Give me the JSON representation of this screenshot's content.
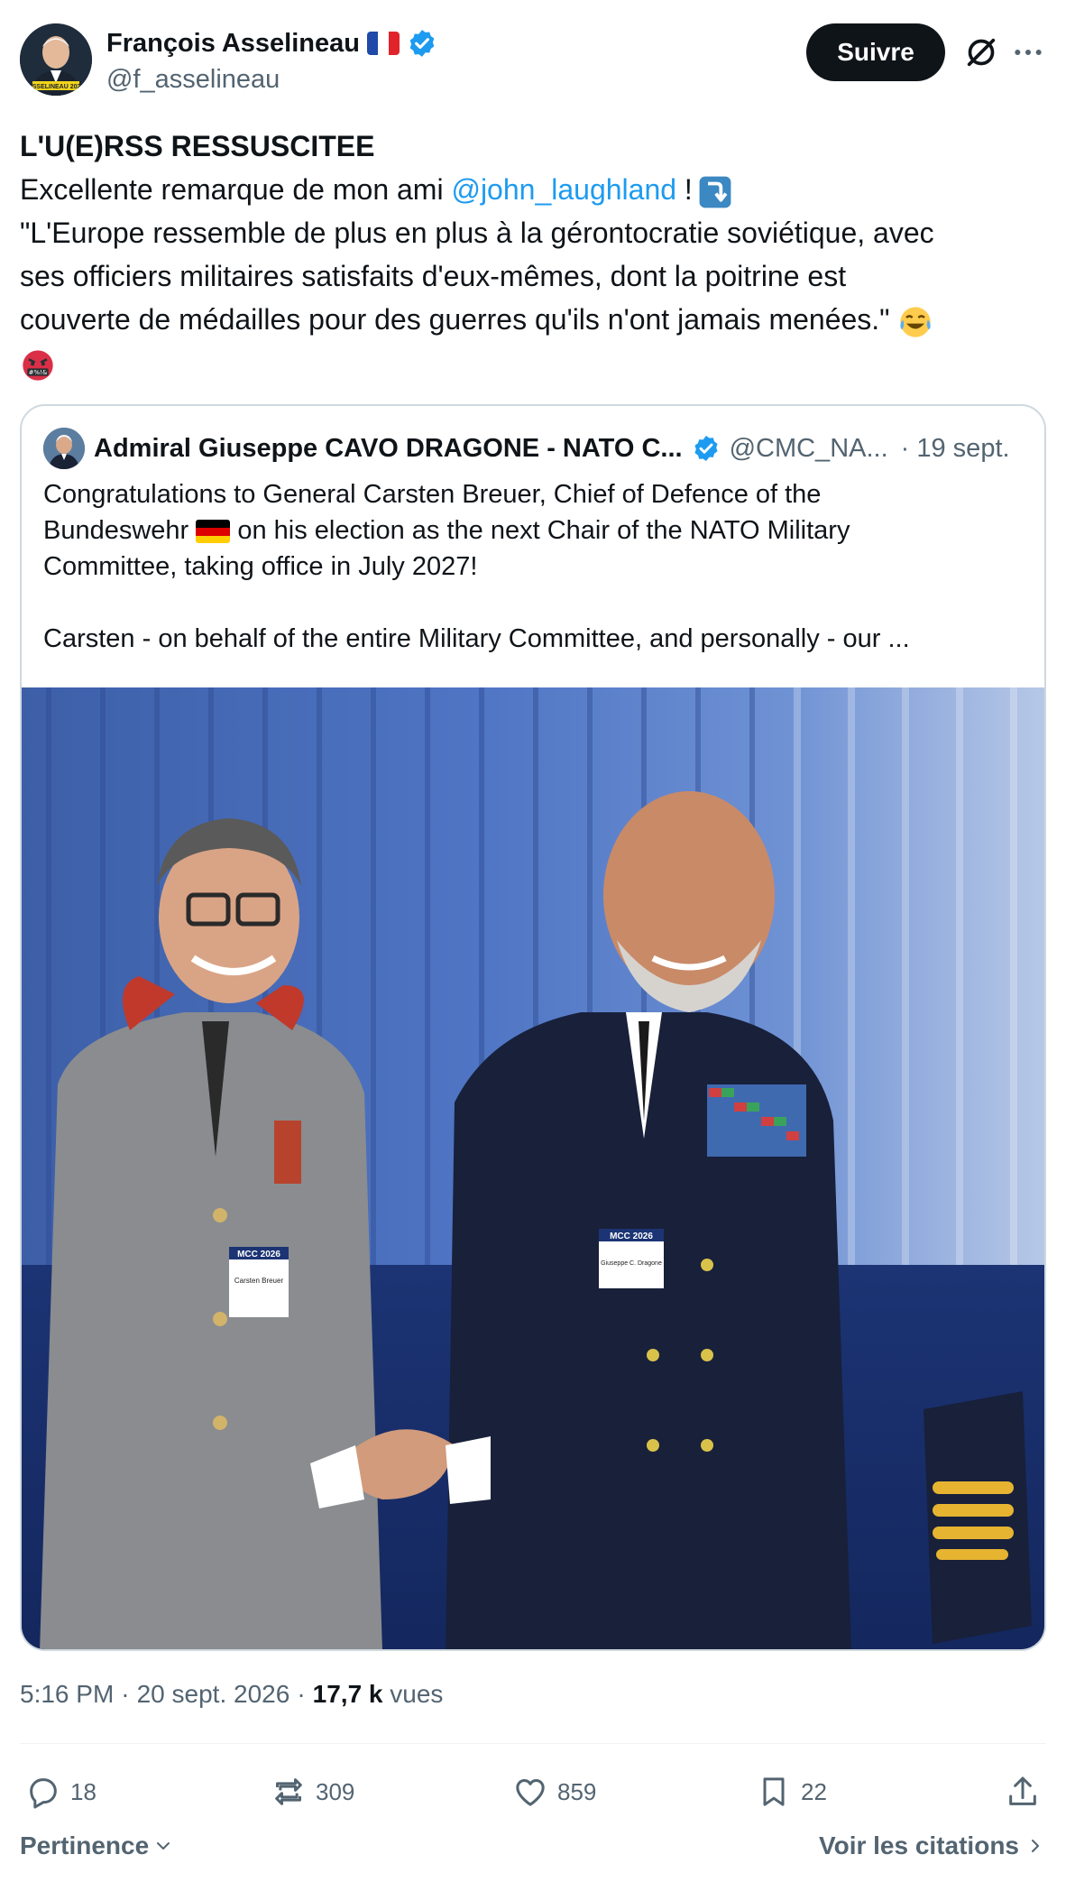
{
  "author": {
    "display_name": "François Asselineau",
    "handle": "@f_asselineau",
    "avatar_caption": "ASSELINEAU 2027"
  },
  "follow_label": "Suivre",
  "tweet": {
    "line1": "L'U(E)RSS RESSUSCITEE",
    "line2_prefix": "Excellente remarque de mon ami ",
    "mention": "@john_laughland",
    "line2_suffix": " !",
    "line3": "\"L'Europe ressemble de plus en plus à la gérontocratie soviétique, avec",
    "line4": "ses officiers militaires satisfaits d'eux-mêmes, dont la poitrine est",
    "line5": "couverte de médailles pour des guerres qu'ils n'ont jamais menées.\" "
  },
  "quote": {
    "name": "Admiral Giuseppe CAVO DRAGONE - NATO C...",
    "handle": "@CMC_NA...",
    "time": "· 19 sept.",
    "line1": "Congratulations to General Carsten Breuer, Chief of Defence of the",
    "line2_prefix": "Bundeswehr ",
    "line2_suffix": " on his election as the next Chair of the NATO Military",
    "line3": "Committee, taking office in July 2027!",
    "line4": "Carsten - on behalf of the entire Military Committee, and personally - our ...",
    "badge_left": "MCC 2026",
    "badge_left_name": "Carsten Breuer",
    "badge_right": "MCC 2026",
    "badge_right_name": "Giuseppe C. Dragone"
  },
  "meta": {
    "time": "5:16 PM",
    "date": "20 sept. 2026",
    "views_count": "17,7 k",
    "views_label": "vues",
    "sep": "·"
  },
  "actions": {
    "replies": "18",
    "reposts": "309",
    "likes": "859",
    "bookmarks": "22"
  },
  "footer": {
    "sort_label": "Pertinence",
    "quotes_label": "Voir les citations"
  },
  "colors": {
    "accent": "#1d9bf0",
    "text": "#0f1419",
    "secondary": "#536471"
  },
  "icons": [
    "verified-badge-icon",
    "grok-icon",
    "more-icon",
    "reply-icon",
    "repost-icon",
    "like-icon",
    "bookmark-icon",
    "share-icon",
    "chevron-down-icon",
    "chevron-right-icon"
  ]
}
